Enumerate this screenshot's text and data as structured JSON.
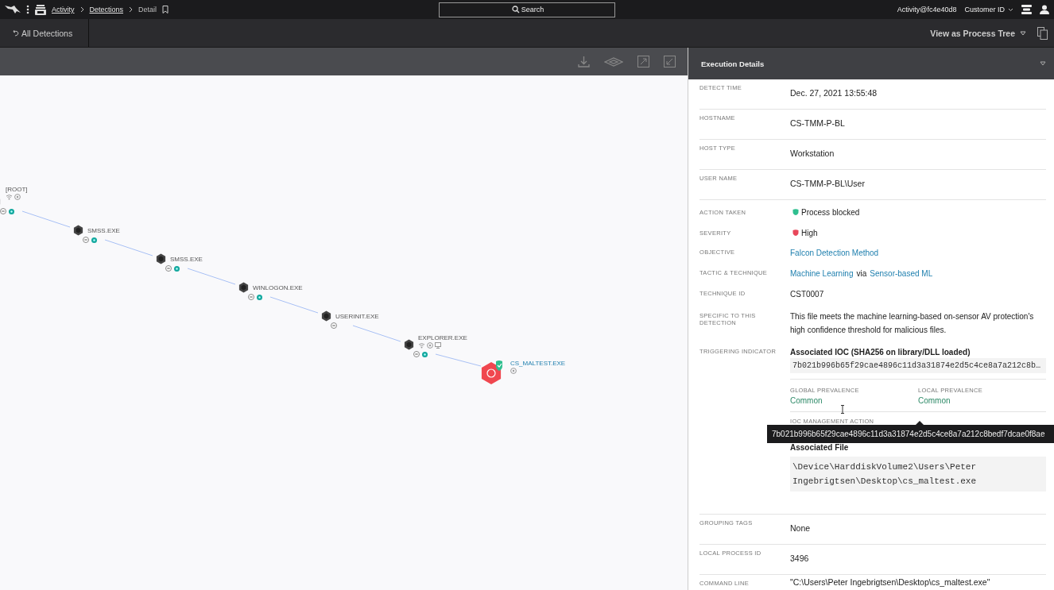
{
  "topbar": {
    "breadcrumbs": [
      {
        "label": "Activity",
        "link": true
      },
      {
        "label": "Detections",
        "link": true
      },
      {
        "label": "Detail",
        "link": false
      }
    ],
    "search": {
      "placeholder": "Search"
    },
    "account": "Activity@fc4e40d8",
    "customer": "Customer ID"
  },
  "subbar": {
    "back": "All Detections",
    "view": "View as Process Tree"
  },
  "tree": {
    "nodes": [
      {
        "name": "[ROOT]",
        "kind": "root",
        "network": true,
        "dns": true,
        "monitor": false,
        "tagged": true
      },
      {
        "name": "SMSS.EXE",
        "kind": "process",
        "network": false,
        "dns": false,
        "monitor": false,
        "tagged": true
      },
      {
        "name": "SMSS.EXE",
        "kind": "process",
        "network": false,
        "dns": false,
        "monitor": false,
        "tagged": true
      },
      {
        "name": "WINLOGON.EXE",
        "kind": "process",
        "network": false,
        "dns": false,
        "monitor": false,
        "tagged": true
      },
      {
        "name": "USERINIT.EXE",
        "kind": "process",
        "network": false,
        "dns": false,
        "monitor": false,
        "tagged": false
      },
      {
        "name": "EXPLORER.EXE",
        "kind": "process",
        "network": true,
        "dns": true,
        "monitor": true,
        "tagged": true
      },
      {
        "name": "CS_MALTEST.EXE",
        "kind": "detection",
        "network": false,
        "dns": true,
        "monitor": false,
        "tagged": false
      }
    ]
  },
  "panel": {
    "title": "Execution Details",
    "rows": [
      {
        "label": "DETECT TIME",
        "kind": "field",
        "value": "Dec. 27, 2021 13:55:48"
      },
      {
        "label": "HOSTNAME",
        "kind": "field",
        "value": "CS-TMM-P-BL"
      },
      {
        "label": "HOST TYPE",
        "kind": "field",
        "value": "Workstation"
      },
      {
        "label": "USER NAME",
        "kind": "field",
        "value": "CS-TMM-P-BL\\User"
      },
      {
        "label": "ACTION TAKEN",
        "kind": "status",
        "value": "Process blocked",
        "color": "#2fbf8f"
      },
      {
        "label": "SEVERITY",
        "kind": "status",
        "value": "High",
        "color": "#e8475a"
      },
      {
        "label": "OBJECTIVE",
        "kind": "links",
        "parts": [
          {
            "text": "Falcon Detection Method",
            "link": true
          }
        ]
      },
      {
        "label": "TACTIC & TECHNIQUE",
        "kind": "links",
        "parts": [
          {
            "text": "Machine Learning",
            "link": true
          },
          {
            "text": "via",
            "link": false
          },
          {
            "text": "Sensor-based ML",
            "link": true
          }
        ]
      },
      {
        "label": "TECHNIQUE ID",
        "kind": "plain",
        "value": "CST0007"
      },
      {
        "label": "SPECIFIC TO THIS DETECTION",
        "kind": "plain",
        "value": "This file meets the machine learning-based on-sensor AV protection's high confidence threshold for malicious files."
      },
      {
        "label": "TRIGGERING INDICATOR",
        "kind": "indicator",
        "ioc_title": "Associated IOC (SHA256 on library/DLL loaded)",
        "ioc_hash": "7b021b996b65f29cae4896c11d3a31874e2d5c4ce8a7a212c8b…",
        "prevalence": [
          {
            "label": "GLOBAL PREVALENCE",
            "value": "Common"
          },
          {
            "label": "LOCAL PREVALENCE",
            "value": "Common"
          }
        ],
        "action_label": "IOC MANAGEMENT ACTION",
        "tooltip": "7b021b996b65f29cae4896c11d3a31874e2d5c4ce8a7a212c8bedf7dcae0f8ae",
        "file_title": "Associated File",
        "file_path": "\\Device\\HarddiskVolume2\\Users\\Peter Ingebrigtsen\\Desktop\\cs_maltest.exe"
      },
      {
        "label": "GROUPING TAGS",
        "kind": "field",
        "value": "None"
      },
      {
        "label": "LOCAL PROCESS ID",
        "kind": "field",
        "value": "3496"
      },
      {
        "label": "COMMAND LINE",
        "kind": "field",
        "value": "\"C:\\Users\\Peter Ingebrigtsen\\Desktop\\cs_maltest.exe\""
      }
    ]
  }
}
